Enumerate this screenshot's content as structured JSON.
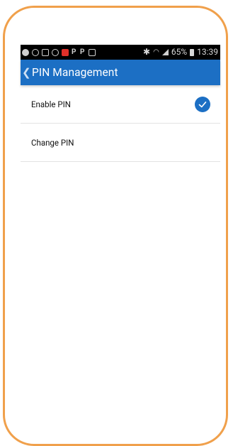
{
  "status_bar": {
    "left_icons": [
      "a-icon",
      "whatsapp-icon",
      "gallery-icon",
      "chrome-icon",
      "notification-red-icon",
      "paypal-icon",
      "paypal-icon",
      "image-icon"
    ],
    "battery_percent": "65%",
    "time": "13:39"
  },
  "app_bar": {
    "back_glyph": "❮",
    "title": "PIN Management"
  },
  "settings": {
    "items": [
      {
        "label": "Enable PIN",
        "checked": true
      },
      {
        "label": "Change PIN",
        "checked": false
      }
    ]
  },
  "colors": {
    "accent": "#1c6fc4",
    "frame_border": "#f0a04b"
  }
}
